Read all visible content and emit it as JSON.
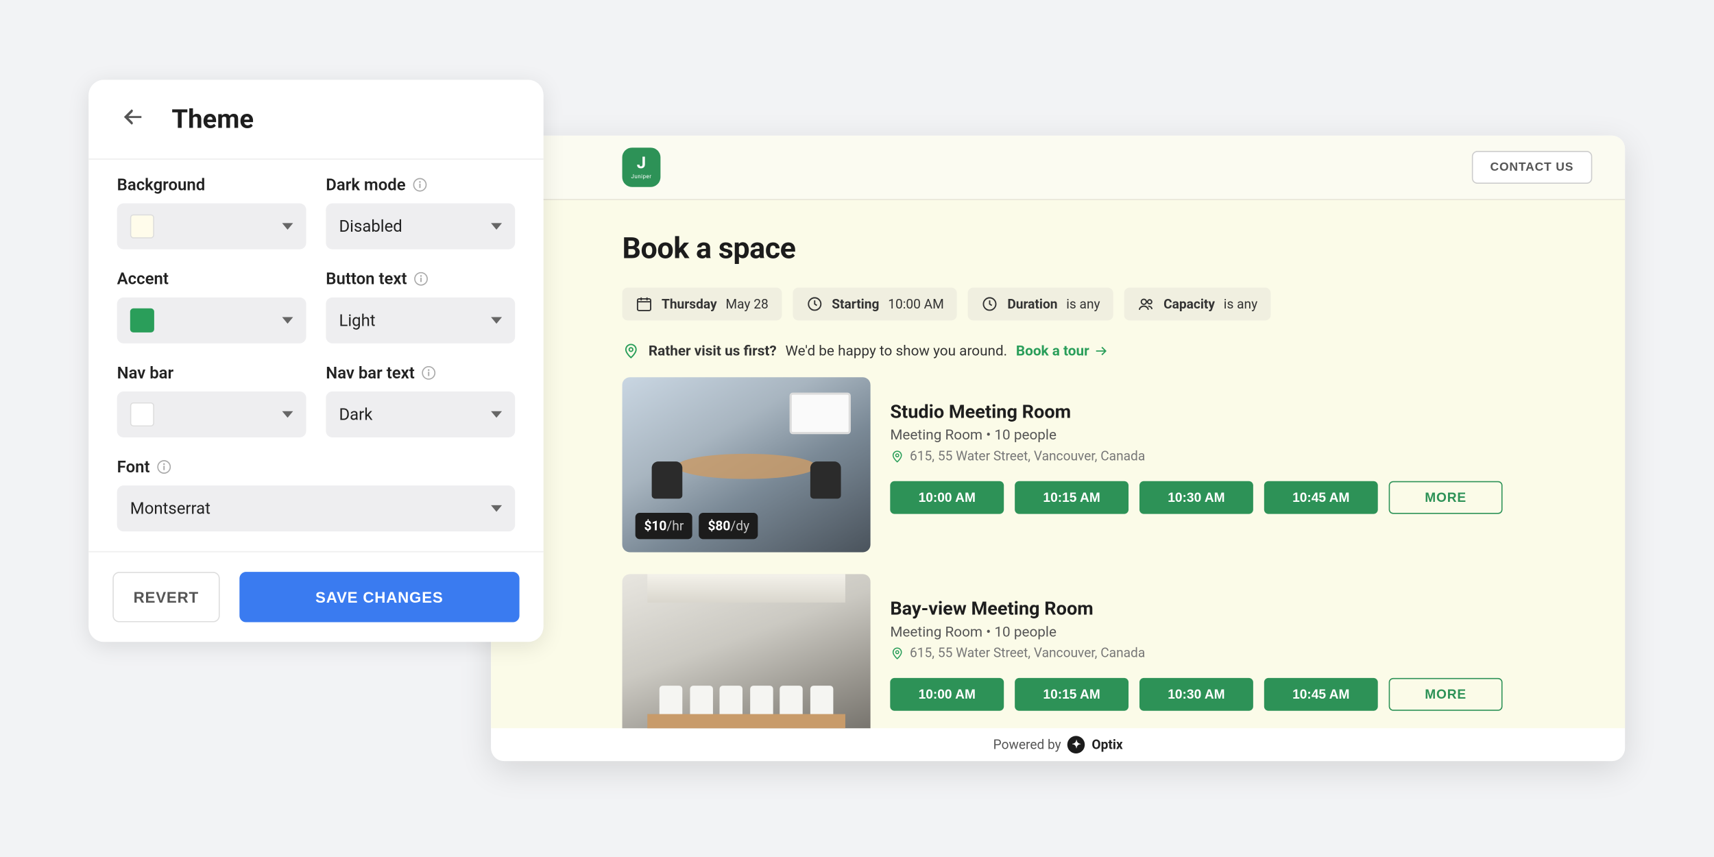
{
  "theme": {
    "title": "Theme",
    "fields": {
      "background": {
        "label": "Background"
      },
      "darkMode": {
        "label": "Dark mode",
        "value": "Disabled"
      },
      "accent": {
        "label": "Accent"
      },
      "buttonText": {
        "label": "Button text",
        "value": "Light"
      },
      "navBar": {
        "label": "Nav bar"
      },
      "navBarText": {
        "label": "Nav bar text",
        "value": "Dark"
      },
      "font": {
        "label": "Font",
        "value": "Montserrat"
      }
    },
    "buttons": {
      "revert": "REVERT",
      "save": "SAVE CHANGES"
    },
    "colors": {
      "background": "#fffceb",
      "accent": "#2a9e5a",
      "navBar": "#ffffff"
    }
  },
  "preview": {
    "brand": {
      "initial": "J",
      "name": "Juniper"
    },
    "contactBtn": "CONTACT US",
    "title": "Book a space",
    "filters": {
      "date": {
        "label": "Thursday",
        "value": "May 28"
      },
      "starting": {
        "label": "Starting",
        "value": "10:00 AM"
      },
      "duration": {
        "label": "Duration",
        "value": "is any"
      },
      "capacity": {
        "label": "Capacity",
        "value": "is any"
      }
    },
    "tour": {
      "question": "Rather visit us first?",
      "text": "We'd be happy to show you around.",
      "link": "Book a tour"
    },
    "listings": [
      {
        "name": "Studio Meeting Room",
        "subtitle": "Meeting Room • 10 people",
        "address": "615, 55 Water Street, Vancouver, Canada",
        "price": {
          "hour": "$10",
          "hourPer": "/hr",
          "day": "$80",
          "dayPer": "/dy"
        },
        "slots": [
          "10:00 AM",
          "10:15 AM",
          "10:30 AM",
          "10:45 AM"
        ],
        "more": "MORE"
      },
      {
        "name": "Bay-view Meeting Room",
        "subtitle": "Meeting Room • 10 people",
        "address": "615, 55 Water Street, Vancouver, Canada",
        "slots": [
          "10:00 AM",
          "10:15 AM",
          "10:30 AM",
          "10:45 AM"
        ],
        "more": "MORE"
      }
    ],
    "poweredBy": {
      "prefix": "Powered by",
      "brand": "Optix"
    }
  }
}
